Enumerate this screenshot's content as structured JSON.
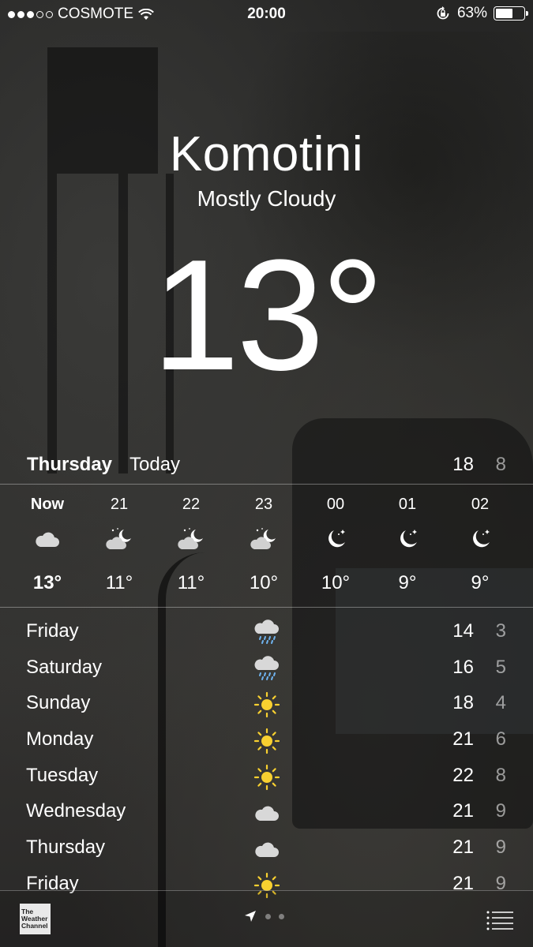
{
  "status_bar": {
    "carrier": "COSMOTE",
    "signal_strength": 3,
    "signal_max": 5,
    "time": "20:00",
    "battery_percent": "63%",
    "battery_level": 0.63
  },
  "location": {
    "city": "Komotini",
    "condition": "Mostly Cloudy",
    "temperature": "13°"
  },
  "today": {
    "day": "Thursday",
    "label": "Today",
    "high": "18",
    "low": "8"
  },
  "hourly": [
    {
      "hour": "Now",
      "icon": "cloud-icon",
      "temp": "13°"
    },
    {
      "hour": "21",
      "icon": "partly-cloudy-night-icon",
      "temp": "11°"
    },
    {
      "hour": "22",
      "icon": "partly-cloudy-night-icon",
      "temp": "11°"
    },
    {
      "hour": "23",
      "icon": "partly-cloudy-night-icon",
      "temp": "10°"
    },
    {
      "hour": "00",
      "icon": "clear-night-icon",
      "temp": "10°"
    },
    {
      "hour": "01",
      "icon": "clear-night-icon",
      "temp": "9°"
    },
    {
      "hour": "02",
      "icon": "clear-night-icon",
      "temp": "9°"
    }
  ],
  "daily": [
    {
      "day": "Friday",
      "icon": "rain-icon",
      "high": "14",
      "low": "3"
    },
    {
      "day": "Saturday",
      "icon": "rain-icon",
      "high": "16",
      "low": "5"
    },
    {
      "day": "Sunday",
      "icon": "sun-icon",
      "high": "18",
      "low": "4"
    },
    {
      "day": "Monday",
      "icon": "sun-icon",
      "high": "21",
      "low": "6"
    },
    {
      "day": "Tuesday",
      "icon": "sun-icon",
      "high": "22",
      "low": "8"
    },
    {
      "day": "Wednesday",
      "icon": "cloud-icon",
      "high": "21",
      "low": "9"
    },
    {
      "day": "Thursday",
      "icon": "cloud-icon",
      "high": "21",
      "low": "9"
    },
    {
      "day": "Friday",
      "icon": "sun-icon",
      "high": "21",
      "low": "9"
    }
  ],
  "footer": {
    "logo_text": "The Weather Channel",
    "page_count": 2
  },
  "colors": {
    "sun": "#f8d030",
    "text": "#ffffff"
  }
}
